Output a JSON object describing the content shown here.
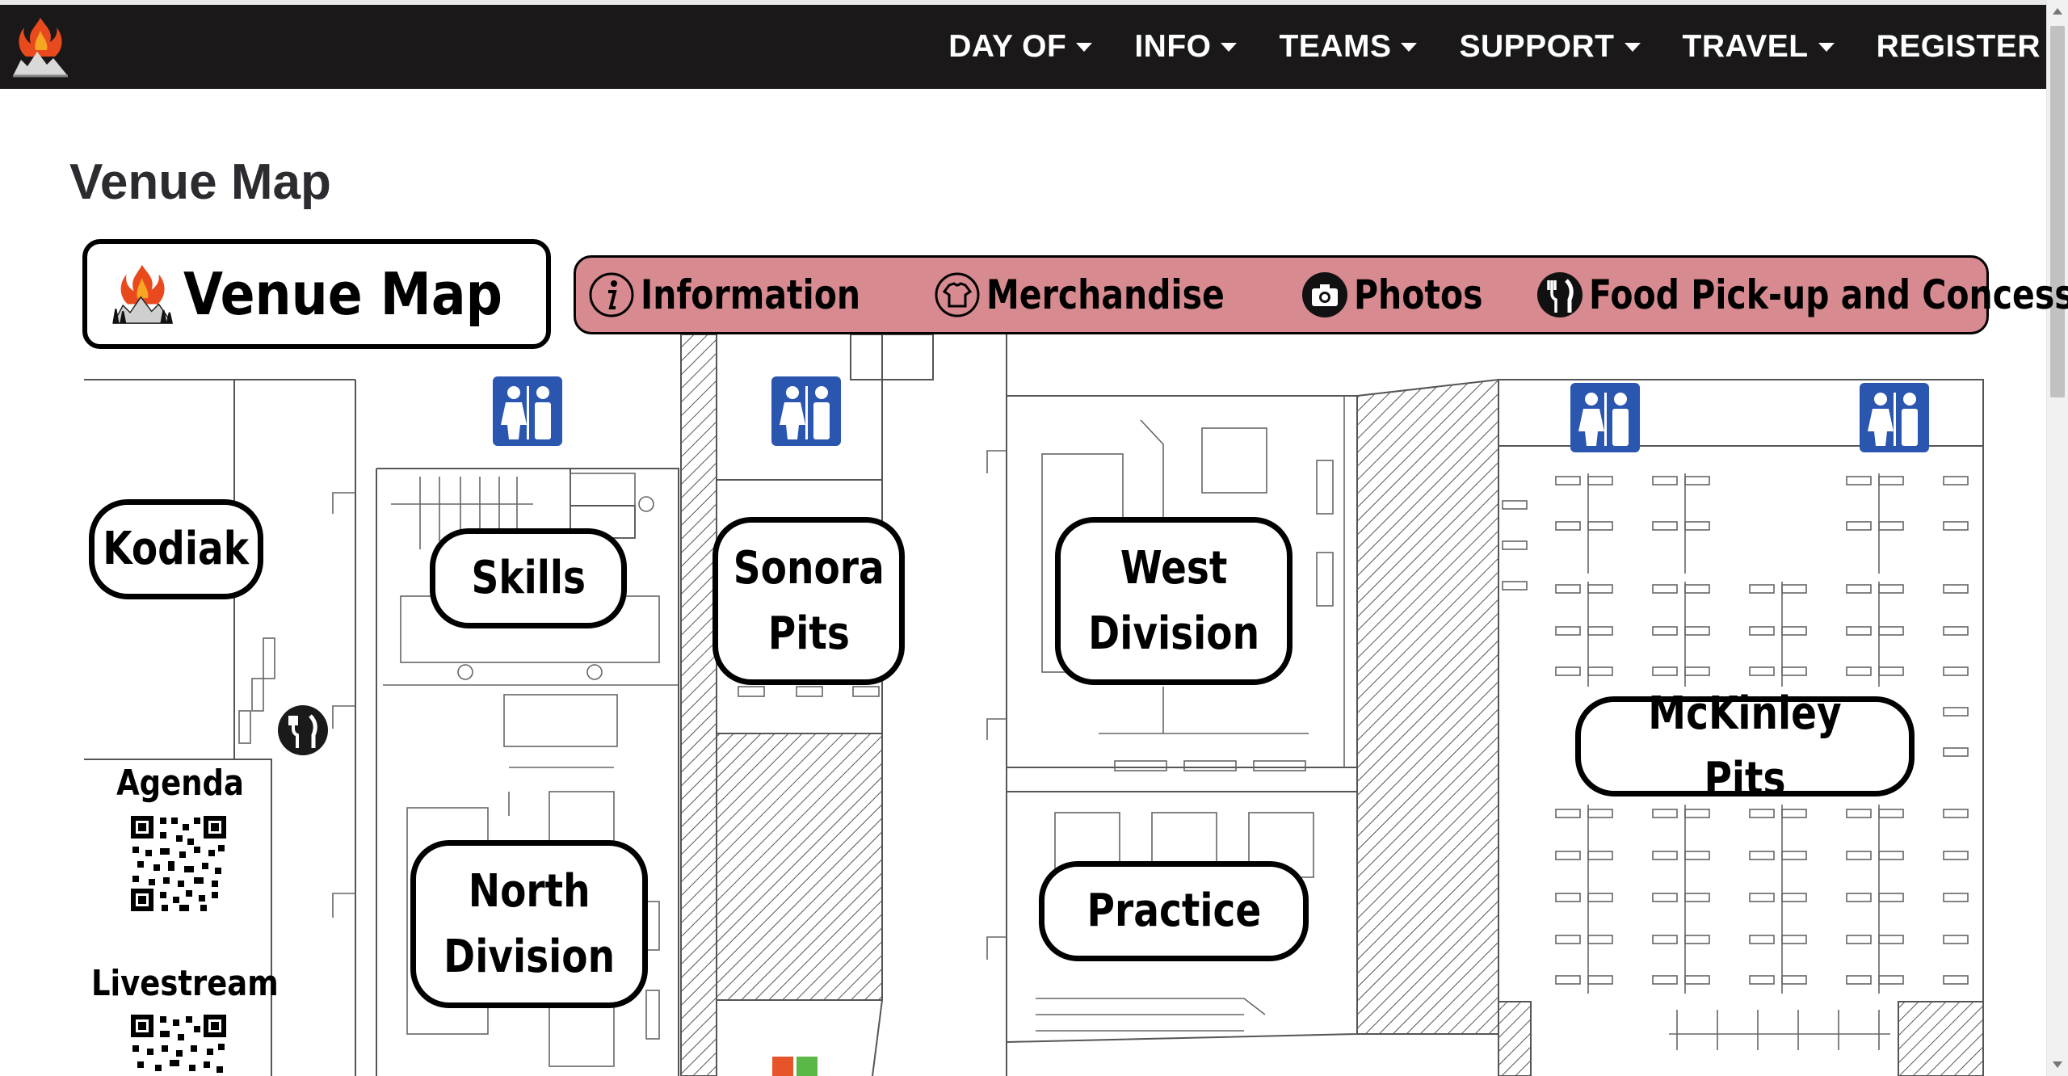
{
  "nav": {
    "items": [
      {
        "label": "DAY OF",
        "dropdown": true
      },
      {
        "label": "INFO",
        "dropdown": true
      },
      {
        "label": "TEAMS",
        "dropdown": true
      },
      {
        "label": "SUPPORT",
        "dropdown": true
      },
      {
        "label": "TRAVEL",
        "dropdown": true
      },
      {
        "label": "REGISTER",
        "dropdown": false
      }
    ]
  },
  "page": {
    "title": "Venue Map"
  },
  "map": {
    "title": "Venue Map",
    "legend": [
      {
        "icon": "information-icon",
        "label": "Information"
      },
      {
        "icon": "merchandise-icon",
        "label": "Merchandise"
      },
      {
        "icon": "camera-icon",
        "label": "Photos"
      },
      {
        "icon": "fork-knife-icon",
        "label": "Food Pick-up and Concessions"
      }
    ],
    "zones": {
      "kodiak": "Kodiak",
      "skills": "Skills",
      "sonora": "Sonora\nPits",
      "west": "West\nDivision",
      "north": "North\nDivision",
      "practice": "Practice",
      "mckinley": "McKinley Pits"
    },
    "qr": {
      "agenda": "Agenda",
      "livestream": "Livestream"
    }
  },
  "colors": {
    "navbar": "#1a1818",
    "legend_bg": "#d78a8f",
    "restroom_sign": "#2a56b0",
    "flame": "#e84a1e"
  }
}
